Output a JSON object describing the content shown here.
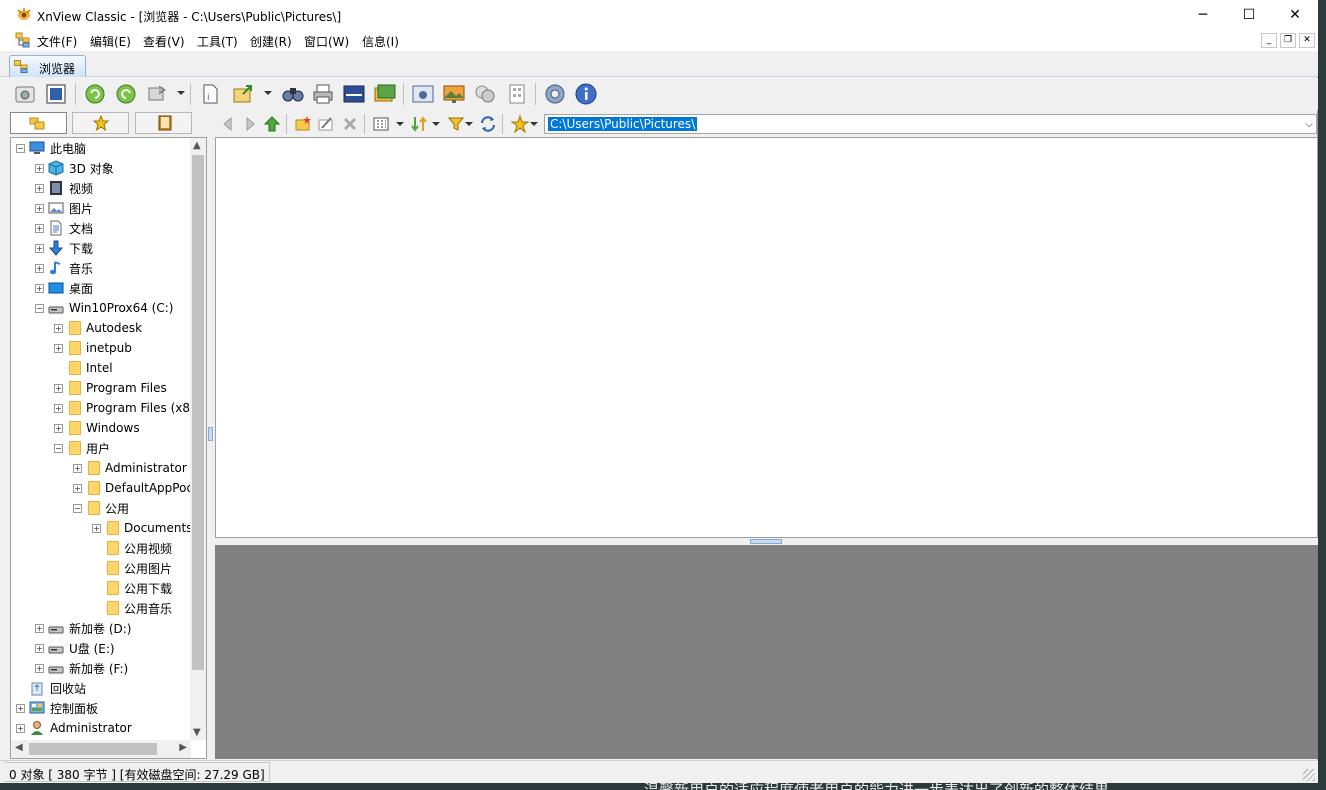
{
  "window": {
    "title": "XnView Classic - [浏览器 - C:\\Users\\Public\\Pictures\\]",
    "minimize": "─",
    "maximize": "☐",
    "close": "✕"
  },
  "menu": {
    "items": [
      "文件(F)",
      "编辑(E)",
      "查看(V)",
      "工具(T)",
      "创建(R)",
      "窗口(W)",
      "信息(I)"
    ]
  },
  "tab": {
    "label": "浏览器"
  },
  "address": {
    "value": "C:\\Users\\Public\\Pictures\\"
  },
  "tree": {
    "nodes": [
      {
        "label": "此电脑",
        "level": 0,
        "state": "minus",
        "icon": "computer-icon"
      },
      {
        "label": "3D 对象",
        "level": 1,
        "state": "plus",
        "icon": "3d-objects-icon"
      },
      {
        "label": "视频",
        "level": 1,
        "state": "plus",
        "icon": "videos-icon"
      },
      {
        "label": "图片",
        "level": 1,
        "state": "plus",
        "icon": "pictures-icon"
      },
      {
        "label": "文档",
        "level": 1,
        "state": "plus",
        "icon": "documents-icon"
      },
      {
        "label": "下载",
        "level": 1,
        "state": "plus",
        "icon": "downloads-icon"
      },
      {
        "label": "音乐",
        "level": 1,
        "state": "plus",
        "icon": "music-icon"
      },
      {
        "label": "桌面",
        "level": 1,
        "state": "plus",
        "icon": "desktop-icon"
      },
      {
        "label": "Win10Prox64 (C:)",
        "level": 1,
        "state": "minus",
        "icon": "drive-icon"
      },
      {
        "label": "Autodesk",
        "level": 2,
        "state": "plus",
        "icon": "folder-icon"
      },
      {
        "label": "inetpub",
        "level": 2,
        "state": "plus",
        "icon": "folder-icon"
      },
      {
        "label": "Intel",
        "level": 2,
        "state": "none",
        "icon": "folder-icon"
      },
      {
        "label": "Program Files",
        "level": 2,
        "state": "plus",
        "icon": "folder-icon"
      },
      {
        "label": "Program Files (x8",
        "level": 2,
        "state": "plus",
        "icon": "folder-icon"
      },
      {
        "label": "Windows",
        "level": 2,
        "state": "plus",
        "icon": "folder-icon"
      },
      {
        "label": "用户",
        "level": 2,
        "state": "minus",
        "icon": "folder-icon"
      },
      {
        "label": "Administrator",
        "level": 3,
        "state": "plus",
        "icon": "folder-icon"
      },
      {
        "label": "DefaultAppPool",
        "level": 3,
        "state": "plus",
        "icon": "folder-icon"
      },
      {
        "label": "公用",
        "level": 3,
        "state": "minus",
        "icon": "folder-icon"
      },
      {
        "label": "Documents",
        "level": 4,
        "state": "plus",
        "icon": "folder-icon"
      },
      {
        "label": "公用视频",
        "level": 4,
        "state": "none",
        "icon": "folder-icon"
      },
      {
        "label": "公用图片",
        "level": 4,
        "state": "none",
        "icon": "folder-icon"
      },
      {
        "label": "公用下载",
        "level": 4,
        "state": "none",
        "icon": "folder-icon"
      },
      {
        "label": "公用音乐",
        "level": 4,
        "state": "none",
        "icon": "folder-icon"
      },
      {
        "label": "新加卷 (D:)",
        "level": 1,
        "state": "plus",
        "icon": "drive-icon"
      },
      {
        "label": "U盘 (E:)",
        "level": 1,
        "state": "plus",
        "icon": "drive-icon"
      },
      {
        "label": "新加卷 (F:)",
        "level": 1,
        "state": "plus",
        "icon": "drive-icon"
      },
      {
        "label": "回收站",
        "level": 0,
        "state": "none",
        "icon": "recycle-bin-icon"
      },
      {
        "label": "控制面板",
        "level": 0,
        "state": "plus",
        "icon": "control-panel-icon"
      },
      {
        "label": "Administrator",
        "level": 0,
        "state": "plus",
        "icon": "user-icon"
      }
    ]
  },
  "status": {
    "text": "0 对象 [ 380 字节 ] [有效磁盘空间: 27.29 GB]"
  },
  "background_caption": "温馨新用户的适应程度使老用户的能力进一步表达出了创新的整体结果",
  "colors": {
    "selection": "#0078d7",
    "preview_bg": "#808080",
    "tab_accent": "#cfe3f7"
  }
}
